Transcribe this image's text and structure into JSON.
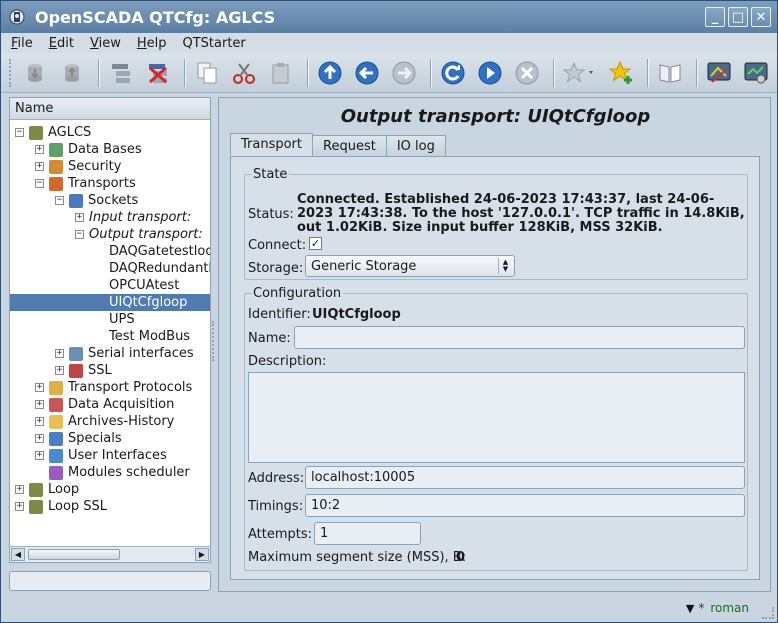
{
  "window": {
    "title": "OpenSCADA QTCfg: AGLCS",
    "buttons": {
      "minimize": "_",
      "maximize": "□",
      "close": "✕"
    }
  },
  "menu": [
    {
      "label": "File",
      "accel": "F",
      "rest": "ile"
    },
    {
      "label": "Edit",
      "accel": "E",
      "rest": "dit"
    },
    {
      "label": "View",
      "accel": "V",
      "rest": "iew"
    },
    {
      "label": "Help",
      "accel": "H",
      "rest": "elp"
    },
    {
      "label": "QTStarter",
      "accel": "",
      "rest": "QTStarter"
    }
  ],
  "toolbar": {
    "icons": [
      "db-load-icon",
      "db-save-icon",
      "add-item-icon",
      "delete-item-icon",
      "copy-icon",
      "cut-icon",
      "paste-icon",
      "up-icon",
      "back-icon",
      "forward-icon",
      "refresh-icon",
      "start-icon",
      "stop-icon",
      "bookmark-icon",
      "bookmark-add-icon",
      "manual-icon",
      "tool1-icon",
      "tool2-icon"
    ]
  },
  "tree": {
    "header": "Name",
    "rows": [
      {
        "label": "AGLCS",
        "level": 0,
        "exp": "−",
        "icon": "#7e8b46",
        "italic": false
      },
      {
        "label": "Data Bases",
        "level": 1,
        "exp": "+",
        "icon": "#5da06a",
        "italic": false
      },
      {
        "label": "Security",
        "level": 1,
        "exp": "+",
        "icon": "#d68a2b",
        "italic": false
      },
      {
        "label": "Transports",
        "level": 1,
        "exp": "−",
        "icon": "#d46a2a",
        "italic": false
      },
      {
        "label": "Sockets",
        "level": 2,
        "exp": "−",
        "icon": "#4a78c0",
        "italic": false
      },
      {
        "label": "Input transport:",
        "level": 3,
        "exp": "+",
        "icon": "",
        "italic": true
      },
      {
        "label": "Output transport:",
        "level": 3,
        "exp": "−",
        "icon": "",
        "italic": true
      },
      {
        "label": "DAQGatetestloo",
        "level": 4,
        "exp": "",
        "icon": "",
        "italic": false
      },
      {
        "label": "DAQRedundantlo",
        "level": 4,
        "exp": "",
        "icon": "",
        "italic": false
      },
      {
        "label": "OPCUAtest",
        "level": 4,
        "exp": "",
        "icon": "",
        "italic": false
      },
      {
        "label": "UIQtCfgloop",
        "level": 4,
        "exp": "",
        "icon": "",
        "italic": false,
        "selected": true
      },
      {
        "label": "UPS",
        "level": 4,
        "exp": "",
        "icon": "",
        "italic": false
      },
      {
        "label": "Test ModBus",
        "level": 4,
        "exp": "",
        "icon": "",
        "italic": false
      },
      {
        "label": "Serial interfaces",
        "level": 2,
        "exp": "+",
        "icon": "#6b8fb8",
        "italic": false
      },
      {
        "label": "SSL",
        "level": 2,
        "exp": "+",
        "icon": "#c04444",
        "italic": false
      },
      {
        "label": "Transport Protocols",
        "level": 1,
        "exp": "+",
        "icon": "#e0b040",
        "italic": false
      },
      {
        "label": "Data Acquisition",
        "level": 1,
        "exp": "+",
        "icon": "#cc5555",
        "italic": false
      },
      {
        "label": "Archives-History",
        "level": 1,
        "exp": "+",
        "icon": "#e8c050",
        "italic": false
      },
      {
        "label": "Specials",
        "level": 1,
        "exp": "+",
        "icon": "#4a7ec8",
        "italic": false
      },
      {
        "label": "User Interfaces",
        "level": 1,
        "exp": "+",
        "icon": "#4a8ad0",
        "italic": false
      },
      {
        "label": "Modules scheduler",
        "level": 1,
        "exp": "",
        "icon": "#9a5cc0",
        "italic": false
      },
      {
        "label": "Loop",
        "level": 0,
        "exp": "+",
        "icon": "#7e8b46",
        "italic": false
      },
      {
        "label": "Loop SSL",
        "level": 0,
        "exp": "+",
        "icon": "#7e8b46",
        "italic": false
      }
    ]
  },
  "page": {
    "title": "Output transport: UIQtCfgloop",
    "tabs": [
      "Transport",
      "Request",
      "IO log"
    ],
    "active_tab": "Transport",
    "state": {
      "legend": "State",
      "status_label": "Status:",
      "status_value": "Connected. Established 24-06-2023 17:43:37, last 24-06-2023 17:43:38. To the host '127.0.0.1'. TCP traffic in 14.8KiB, out 1.02KiB. Size input buffer 128KiB, MSS 32KiB.",
      "connect_label": "Connect:",
      "connect_checked": "✓",
      "storage_label": "Storage:",
      "storage_value": "Generic Storage"
    },
    "config": {
      "legend": "Configuration",
      "identifier_label": "Identifier:",
      "identifier_value": "UIQtCfgloop",
      "name_label": "Name:",
      "name_value": "",
      "description_label": "Description:",
      "description_value": "",
      "address_label": "Address:",
      "address_value": "localhost:10005",
      "timings_label": "Timings:",
      "timings_value": "10:2",
      "attempts_label": "Attempts:",
      "attempts_value": "1",
      "mss_label": "Maximum segment size (MSS), B:",
      "mss_value": "0"
    }
  },
  "statusbar": {
    "user": "roman",
    "modified_mark": "*"
  }
}
